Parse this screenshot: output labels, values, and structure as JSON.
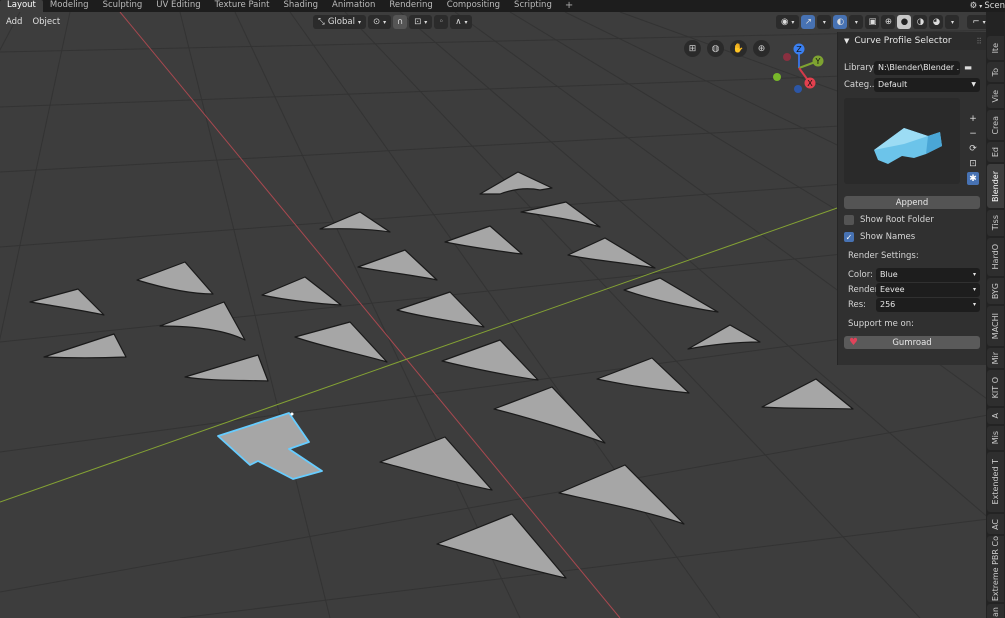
{
  "workspace_tabs": [
    "Layout",
    "Modeling",
    "Sculpting",
    "UV Editing",
    "Texture Paint",
    "Shading",
    "Animation",
    "Rendering",
    "Compositing",
    "Scripting"
  ],
  "add_tab_icon": "plus-icon",
  "scene_label": "Scen",
  "viewport_menu": {
    "add": "Add",
    "object": "Object"
  },
  "transform_orientation": "Global",
  "panel": {
    "title": "Curve Profile Selector",
    "library_label": "Library:",
    "library_value": "N:\\Blender\\Blender ...",
    "category_label": "Categ..",
    "category_value": "Default",
    "append_label": "Append",
    "show_root_folder": "Show Root Folder",
    "show_root_folder_checked": false,
    "show_names": "Show Names",
    "show_names_checked": true,
    "render_settings_label": "Render Settings:",
    "color_label": "Color:",
    "color_value": "Blue",
    "render_label": "Render:",
    "render_value": "Eevee",
    "res_label": "Res:",
    "res_value": "256",
    "support_label": "Support me on:",
    "gumroad_label": "Gumroad"
  },
  "gizmo": {
    "x": "X",
    "y": "Y",
    "z": "Z"
  },
  "side_tabs": [
    "Ite",
    "To",
    "Vie",
    "Crea",
    "Ed",
    "Blender",
    "Tiss",
    "HardO",
    "BYG",
    "MACHI",
    "Mir",
    "KIT O",
    "A",
    "Mis",
    "Extended T",
    "AC",
    "Extreme PBR Co",
    "an"
  ],
  "active_side_tab": "Blender",
  "colors": {
    "viewport_bg": "#3d3d3d",
    "grid_line": "#333333",
    "x_axis": "#a8484f",
    "y_axis": "#84a234",
    "profile_fill": "#a6a6a6",
    "selected_outline": "#66ccff",
    "accent": "#4772b3"
  }
}
